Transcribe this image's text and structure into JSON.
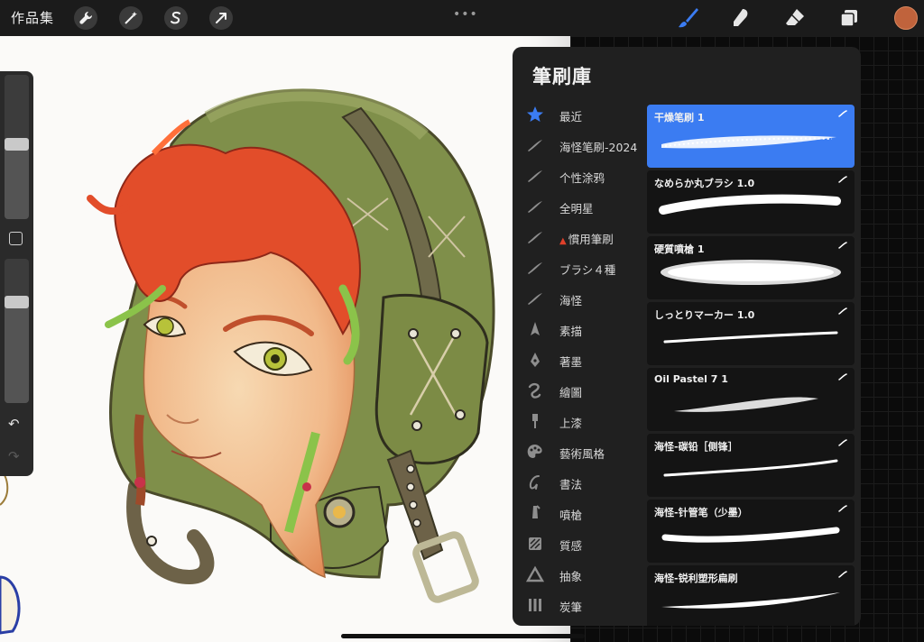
{
  "topbar": {
    "gallery_label": "作品集",
    "tools": [
      {
        "name": "wrench-icon"
      },
      {
        "name": "magic-wand-icon"
      },
      {
        "name": "selection-s-icon"
      },
      {
        "name": "transform-arrow-icon"
      }
    ],
    "more_label": "•••",
    "right_tools": [
      {
        "name": "brush-icon",
        "active": true
      },
      {
        "name": "smudge-icon",
        "active": false
      },
      {
        "name": "eraser-icon",
        "active": false
      },
      {
        "name": "layers-icon",
        "active": false
      }
    ],
    "current_color": "#c0633c",
    "accent": "#3b7cf2"
  },
  "sidebar": {
    "brush_size_level": 0.52,
    "opacity_level": 0.7,
    "undo_label": "↶",
    "redo_label": "↷"
  },
  "brush_library": {
    "title": "筆刷庫",
    "sets": [
      {
        "label": "最近",
        "icon": "star-icon"
      },
      {
        "label": "海怪笔刷-2024",
        "icon": "stroke-icon"
      },
      {
        "label": "个性涂鸦",
        "icon": "stroke-icon"
      },
      {
        "label": "全明星",
        "icon": "stroke-icon"
      },
      {
        "label": "慣用筆刷",
        "icon": "stroke-icon",
        "prefix": "▲"
      },
      {
        "label": "ブラシ４種",
        "icon": "stroke-icon"
      },
      {
        "label": "海怪",
        "icon": "stroke-icon"
      },
      {
        "label": "素描",
        "icon": "pencil-tip-icon"
      },
      {
        "label": "著墨",
        "icon": "pen-nib-icon"
      },
      {
        "label": "繪圖",
        "icon": "squiggle-icon"
      },
      {
        "label": "上漆",
        "icon": "paintbrush-icon"
      },
      {
        "label": "藝術風格",
        "icon": "palette-icon"
      },
      {
        "label": "書法",
        "icon": "calligraphy-icon"
      },
      {
        "label": "噴槍",
        "icon": "airbrush-icon"
      },
      {
        "label": "質感",
        "icon": "texture-icon"
      },
      {
        "label": "抽象",
        "icon": "triangle-icon"
      },
      {
        "label": "炭筆",
        "icon": "charcoal-icon"
      }
    ],
    "brushes": [
      {
        "name": "干燥笔刷 1",
        "selected": true
      },
      {
        "name": "なめらか丸ブラシ 1.0",
        "selected": false
      },
      {
        "name": "硬質噴槍 1",
        "selected": false
      },
      {
        "name": "しっとりマーカー 1.0",
        "selected": false
      },
      {
        "name": "Oil Pastel 7 1",
        "selected": false
      },
      {
        "name": "海怪-碳铅［侧锋］",
        "selected": false
      },
      {
        "name": "海怪-针管笔（少墨）",
        "selected": false
      },
      {
        "name": "海怪-锐利塑形扁刷",
        "selected": false
      }
    ]
  }
}
